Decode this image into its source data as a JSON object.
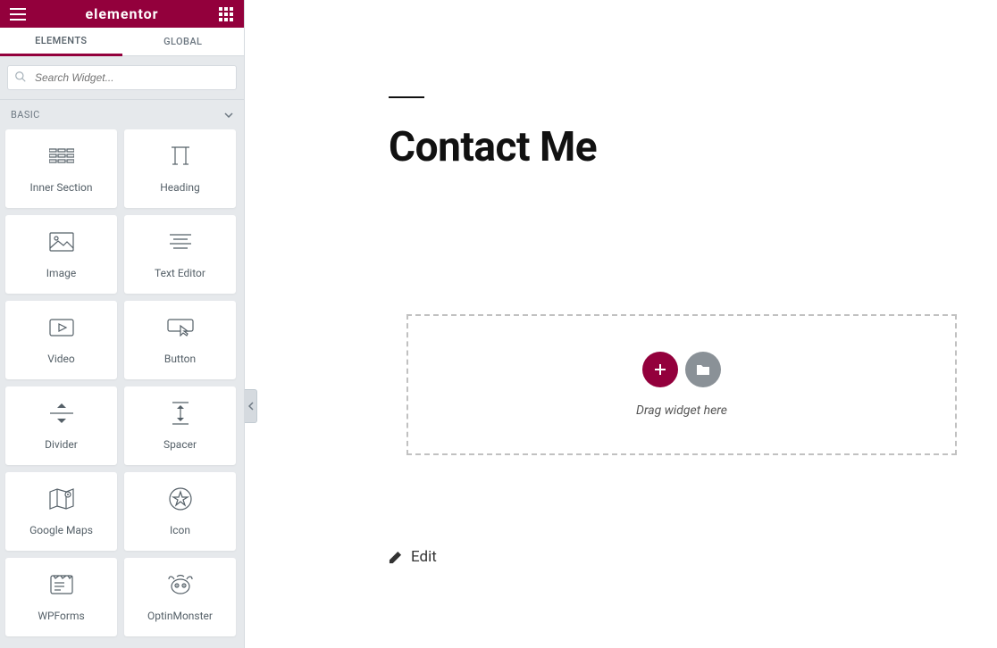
{
  "header": {
    "brand": "elementor"
  },
  "tabs": {
    "elements": "ELEMENTS",
    "global": "GLOBAL"
  },
  "search": {
    "placeholder": "Search Widget..."
  },
  "category": {
    "basic": "BASIC"
  },
  "widgets": {
    "inner_section": "Inner Section",
    "heading": "Heading",
    "image": "Image",
    "text_editor": "Text Editor",
    "video": "Video",
    "button": "Button",
    "divider": "Divider",
    "spacer": "Spacer",
    "google_maps": "Google Maps",
    "icon": "Icon",
    "wpforms": "WPForms",
    "optinmonster": "OptinMonster"
  },
  "canvas": {
    "page_title": "Contact Me",
    "drop_hint": "Drag widget here",
    "edit_label": "Edit"
  }
}
